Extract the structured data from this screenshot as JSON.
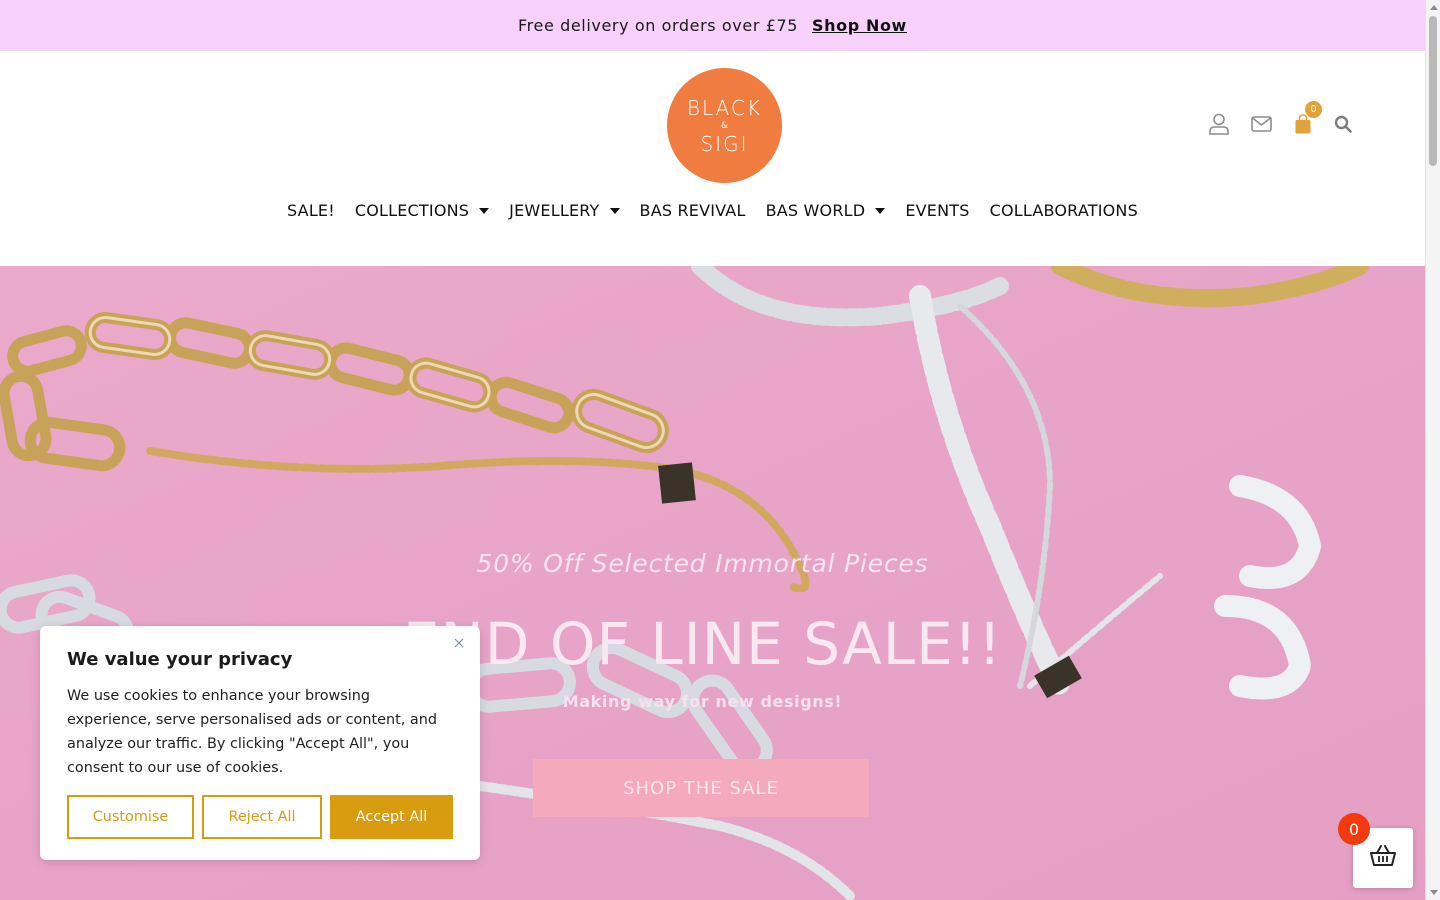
{
  "promo": {
    "text": "Free delivery on orders over £75",
    "link_label": "Shop Now"
  },
  "brand": {
    "logo_line1": "BLACK",
    "logo_amp": "&",
    "logo_line2": "SIGI",
    "logo_color": "#f07d3f"
  },
  "header_icons": {
    "account": "user-icon",
    "contact": "envelope-icon",
    "cart": "shopping-bag-icon",
    "cart_count": "0",
    "search": "search-icon"
  },
  "nav": {
    "items": [
      {
        "label": "SALE!",
        "dropdown": false
      },
      {
        "label": "COLLECTIONS",
        "dropdown": true
      },
      {
        "label": "JEWELLERY",
        "dropdown": true
      },
      {
        "label": "BAS REVIVAL",
        "dropdown": false
      },
      {
        "label": "BAS WORLD",
        "dropdown": true
      },
      {
        "label": "EVENTS",
        "dropdown": false
      },
      {
        "label": "COLLABORATIONS",
        "dropdown": false
      }
    ]
  },
  "hero": {
    "subtitle": "50% Off Selected Immortal Pieces",
    "title": "END OF LINE SALE!!",
    "description": "Making way for new designs!",
    "button_label": "SHOP THE SALE",
    "background_color": "#e7a5c8"
  },
  "cookie": {
    "title": "We value your privacy",
    "body": "We use cookies to enhance your browsing experience, serve personalised ads or content, and analyze our traffic. By clicking \"Accept All\", you consent to our use of cookies.",
    "customise_label": "Customise",
    "reject_label": "Reject All",
    "accept_label": "Accept All",
    "close_icon": "close-icon",
    "accent_color": "#d79c10"
  },
  "floating_basket": {
    "icon": "basket-icon",
    "count": "0"
  }
}
